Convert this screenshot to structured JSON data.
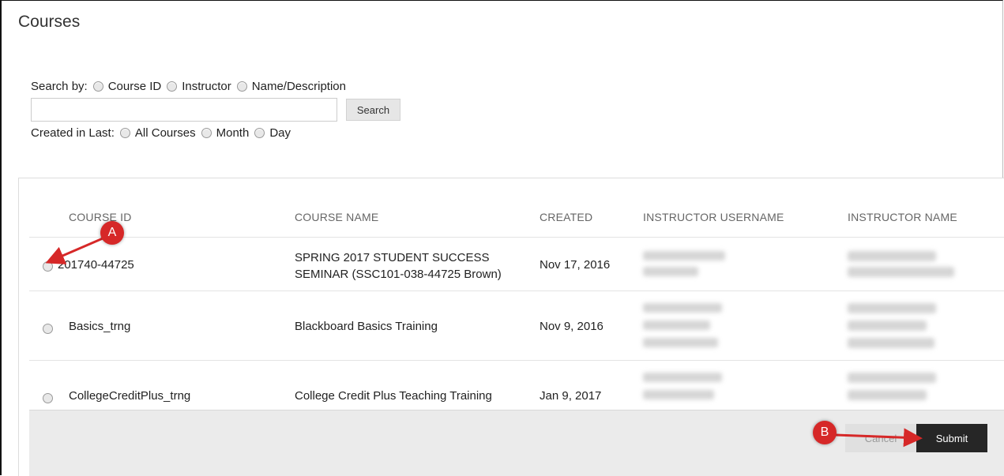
{
  "page": {
    "title": "Courses"
  },
  "search": {
    "label": "Search by:",
    "options": [
      "Course ID",
      "Instructor",
      "Name/Description"
    ],
    "input_value": "",
    "button_label": "Search"
  },
  "created": {
    "label": "Created in Last:",
    "options": [
      "All Courses",
      "Month",
      "Day"
    ]
  },
  "table": {
    "headers": [
      "COURSE ID",
      "COURSE NAME",
      "CREATED",
      "INSTRUCTOR USERNAME",
      "INSTRUCTOR NAME"
    ],
    "rows": [
      {
        "course_id": "201740-44725",
        "course_name_line1": "SPRING 2017 STUDENT SUCCESS",
        "course_name_line2": "SEMINAR (SSC101-038-44725 Brown)",
        "created": "Nov 17, 2016"
      },
      {
        "course_id": "Basics_trng",
        "course_name_line1": "Blackboard Basics Training",
        "created": "Nov 9, 2016"
      },
      {
        "course_id": "CollegeCreditPlus_trng",
        "course_name_line1": "College Credit Plus Teaching Training",
        "created": "Jan 9, 2017"
      }
    ]
  },
  "footer": {
    "cancel_label": "Cancel",
    "submit_label": "Submit"
  },
  "markers": {
    "a": "A",
    "b": "B"
  },
  "colors": {
    "marker": "#d62828",
    "submit_bg": "#262626"
  }
}
